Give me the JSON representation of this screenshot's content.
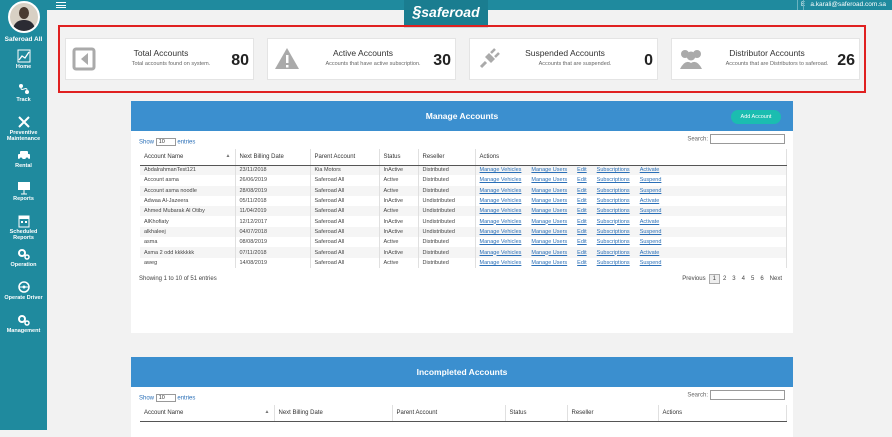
{
  "sidebar": {
    "user_name": "Saferoad All",
    "items": [
      {
        "label": "Home",
        "icon": "chart-icon"
      },
      {
        "label": "Track",
        "icon": "track-icon"
      },
      {
        "label": "Preventive Maintenance",
        "icon": "tools-icon"
      },
      {
        "label": "Rental",
        "icon": "car-icon"
      },
      {
        "label": "Reports",
        "icon": "presentation-icon"
      },
      {
        "label": "Scheduled Reports",
        "icon": "calendar-icon"
      },
      {
        "label": "Operation",
        "icon": "gears-icon"
      },
      {
        "label": "Operate Driver",
        "icon": "driver-icon"
      },
      {
        "label": "Management",
        "icon": "gears-icon"
      }
    ]
  },
  "topbar": {
    "lang": "E",
    "user_email": "a.karali@saferoad.com.sa"
  },
  "logo": {
    "text": "saferoad"
  },
  "stats": [
    {
      "title": "Total Accounts",
      "subtitle": "Total accounts found on system.",
      "value": "80",
      "icon": "back-arrow-icon"
    },
    {
      "title": "Active Accounts",
      "subtitle": "Accounts that have active subscription.",
      "value": "30",
      "icon": "warning-icon"
    },
    {
      "title": "Suspended Accounts",
      "subtitle": "Accounts that are suspended.",
      "value": "0",
      "icon": "plug-icon"
    },
    {
      "title": "Distributor Accounts",
      "subtitle": "Accounts that are Distributors to saferoad.",
      "value": "26",
      "icon": "users-icon"
    }
  ],
  "manage": {
    "title": "Manage Accounts",
    "add_label": "Add Account",
    "show_label": "Show",
    "show_value": "10",
    "entries_label": "entries",
    "search_label": "Search:",
    "columns": [
      "Account Name",
      "Next Billing Date",
      "Parent Account",
      "Status",
      "Reseller",
      "Actions"
    ],
    "rows": [
      [
        "AbdalrahmanTest121",
        "23/11/2018",
        "Kia Motors",
        "InActive",
        "Distributed"
      ],
      [
        "Account asma",
        "26/06/2019",
        "Saferoad All",
        "Active",
        "Distributed"
      ],
      [
        "Account asma noodle",
        "28/08/2019",
        "Saferoad All",
        "Active",
        "Distributed"
      ],
      [
        "Adwaa Al-Jazeera",
        "05/11/2018",
        "Saferoad All",
        "InActive",
        "Undistributed"
      ],
      [
        "Ahmed Mubarak Al Otiby",
        "11/04/2019",
        "Saferoad All",
        "Active",
        "Undistributed"
      ],
      [
        "AlKhofiaty",
        "12/12/2017",
        "Saferoad All",
        "InActive",
        "Undistributed"
      ],
      [
        "alkhaleej",
        "04/07/2018",
        "Saferoad All",
        "InActive",
        "Undistributed"
      ],
      [
        "asma",
        "08/08/2019",
        "Saferoad All",
        "Active",
        "Distributed"
      ],
      [
        "Asma 2 odd kkkkkkk",
        "07/11/2018",
        "Saferoad All",
        "InActive",
        "Distributed"
      ],
      [
        "aweg",
        "14/08/2019",
        "Saferoad All",
        "Active",
        "Distributed"
      ]
    ],
    "actions": [
      "Manage Vehicles",
      "Manage Users",
      "Edit",
      "Subscriptions"
    ],
    "row_last_action": [
      "Activate",
      "Suspend",
      "Suspend",
      "Activate",
      "Suspend",
      "Activate",
      "Suspend",
      "Suspend",
      "Activate",
      "Suspend"
    ],
    "info": "Showing 1 to 10 of 51 entries",
    "pager": [
      "Previous",
      "1",
      "2",
      "3",
      "4",
      "5",
      "6",
      "Next"
    ]
  },
  "incomplete": {
    "title": "Incompleted Accounts",
    "show_label": "Show",
    "show_value": "10",
    "entries_label": "entries",
    "search_label": "Search:",
    "columns": [
      "Account Name",
      "Next Billing Date",
      "Parent Account",
      "Status",
      "Reseller",
      "Actions"
    ]
  }
}
